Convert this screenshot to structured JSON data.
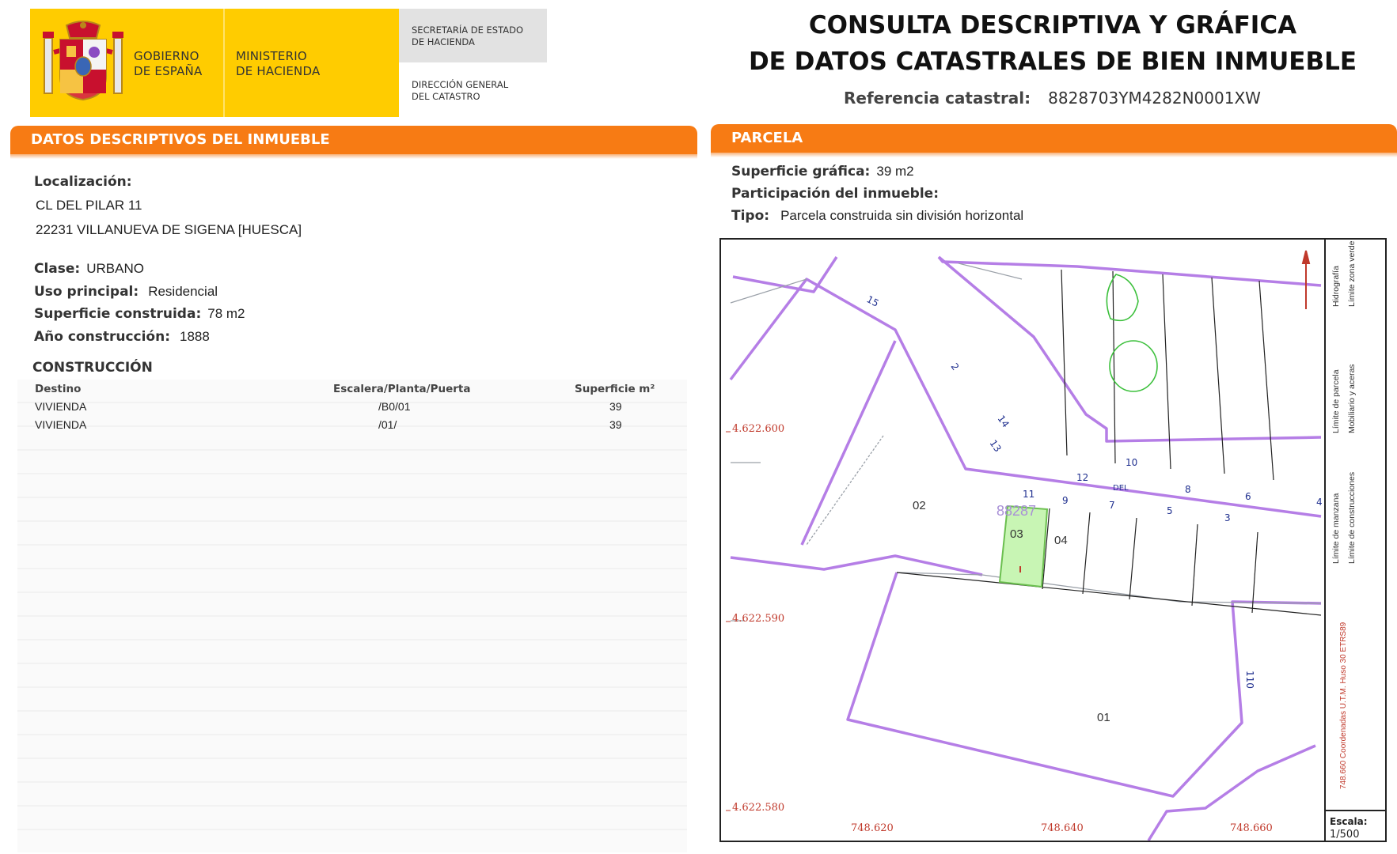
{
  "header": {
    "gov_line1": "GOBIERNO",
    "gov_line2": "DE ESPAÑA",
    "min_line1": "MINISTERIO",
    "min_line2": "DE HACIENDA",
    "sec_line1": "SECRETARÍA DE ESTADO",
    "sec_line2": "DE HACIENDA",
    "dg_line1": "DIRECCIÓN GENERAL",
    "dg_line2": "DEL CATASTRO",
    "title_line1": "CONSULTA DESCRIPTIVA Y GRÁFICA",
    "title_line2": "DE DATOS CATASTRALES DE BIEN INMUEBLE",
    "ref_label": "Referencia catastral:",
    "ref_value": "8828703YM4282N0001XW"
  },
  "colors": {
    "brand_yellow": "#ffcc00",
    "accent_orange": "#f77b14",
    "parcel_line": "#b57ee6",
    "selected_parcel": "#c8f5b4",
    "coord_red": "#c0392b",
    "street_blue": "#1f2f8f"
  },
  "descriptive": {
    "section_title": "DATOS DESCRIPTIVOS DEL INMUEBLE",
    "location_label": "Localización:",
    "address_line1": "CL DEL PILAR 11",
    "address_line2": "22231 VILLANUEVA DE SIGENA [HUESCA]",
    "clase_label": "Clase:",
    "clase_value": "URBANO",
    "uso_label": "Uso principal:",
    "uso_value": "Residencial",
    "sup_label": "Superficie construida:",
    "sup_value": "78 m2",
    "anio_label": "Año construcción:",
    "anio_value": "1888"
  },
  "construccion": {
    "title": "CONSTRUCCIÓN",
    "headers": [
      "Destino",
      "Escalera/Planta/Puerta",
      "Superficie m²"
    ],
    "rows": [
      [
        "VIVIENDA",
        "/B0/01",
        "39"
      ],
      [
        "VIVIENDA",
        "/01/",
        "39"
      ]
    ]
  },
  "parcela": {
    "section_title": "PARCELA",
    "sup_label": "Superficie gráfica:",
    "sup_value": "39 m2",
    "part_label": "Participación del inmueble:",
    "tipo_label": "Tipo:",
    "tipo_value": "Parcela construida sin división horizontal"
  },
  "map": {
    "y_coords": [
      "4.622.600",
      "4.622.590",
      "4.622.580"
    ],
    "x_coords": [
      "748.620",
      "748.640",
      "748.660"
    ],
    "parcel_labels": {
      "p01": "01",
      "p02": "02",
      "p03": "03",
      "p04": "04",
      "block": "88287"
    },
    "street_numbers": [
      "15",
      "2",
      "14",
      "13",
      "11",
      "12",
      "10",
      "9",
      "DEL",
      "7",
      "8",
      "5",
      "6",
      "3",
      "4",
      "110"
    ],
    "legend": {
      "col1_top": "Límite de manzana",
      "col1_mid": "Límite de parcela",
      "col1_bot": "Hidrografía",
      "col2_top": "Límite de construcciones",
      "col2_mid": "Mobiliario y aceras",
      "col2_bot": "Límite zona verde",
      "coords_note": "748.660 Coordenadas U.T.M. Huso 30 ETRS89"
    },
    "scale_label": "Escala:",
    "scale_value": "1/500"
  }
}
